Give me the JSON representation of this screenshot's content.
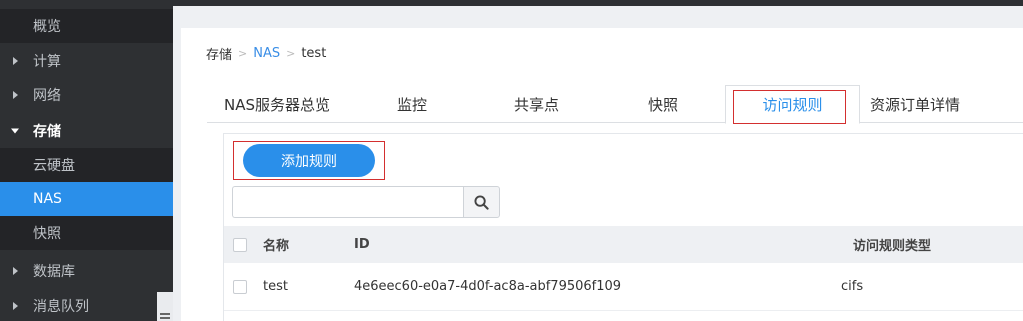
{
  "sidebar": {
    "items": [
      {
        "label": "概览"
      },
      {
        "label": "计算"
      },
      {
        "label": "网络"
      },
      {
        "label": "存储"
      },
      {
        "label": "云硬盘"
      },
      {
        "label": "NAS"
      },
      {
        "label": "快照"
      },
      {
        "label": "数据库"
      },
      {
        "label": "消息队列"
      }
    ]
  },
  "breadcrumb": {
    "root": "存储",
    "sep1": ">",
    "mid": "NAS",
    "sep2": ">",
    "current": "test"
  },
  "tabs": [
    {
      "label": "NAS服务器总览"
    },
    {
      "label": "监控"
    },
    {
      "label": "共享点"
    },
    {
      "label": "快照"
    },
    {
      "label": "访问规则"
    },
    {
      "label": "资源订单详情"
    }
  ],
  "toolbar": {
    "add_rule_label": "添加规则"
  },
  "search": {
    "value": "",
    "placeholder": ""
  },
  "table": {
    "columns": {
      "name": "名称",
      "id": "ID",
      "type": "访问规则类型"
    },
    "rows": [
      {
        "name": "test",
        "id": "4e6eec60-e0a7-4d0f-ac8a-abf79506f109",
        "type": "cifs"
      }
    ]
  },
  "colors": {
    "accent": "#2a8fea",
    "sidebar_bg": "#2e3033",
    "highlight_box": "#d32f2f"
  }
}
